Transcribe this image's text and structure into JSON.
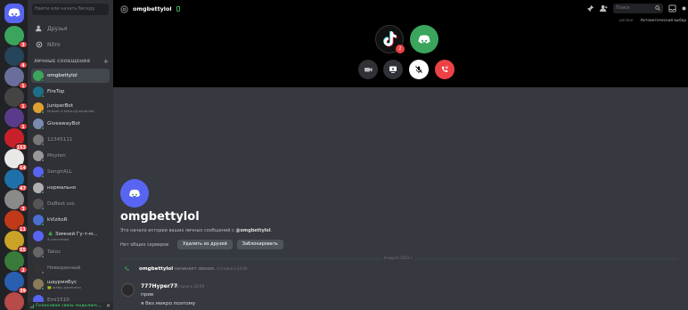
{
  "servers": [
    {
      "type": "home",
      "icon": "discord-logo-icon",
      "badge": ""
    },
    {
      "icon": "server-icon",
      "badge": "3"
    },
    {
      "icon": "server-icon",
      "badge": "4"
    },
    {
      "icon": "server-icon",
      "badge": "1"
    },
    {
      "icon": "server-icon",
      "badge": "1"
    },
    {
      "icon": "server-icon",
      "badge": "1"
    },
    {
      "icon": "server-icon",
      "badge": "153"
    },
    {
      "icon": "server-icon",
      "badge": "14"
    },
    {
      "icon": "server-icon",
      "badge": "47"
    },
    {
      "icon": "server-icon",
      "badge": "3"
    },
    {
      "icon": "server-icon",
      "badge": "11"
    },
    {
      "icon": "server-icon",
      "badge": "55"
    },
    {
      "icon": "server-icon",
      "badge": "2"
    },
    {
      "icon": "server-icon",
      "badge": "39"
    },
    {
      "icon": "server-icon",
      "badge": ""
    }
  ],
  "sidebar": {
    "search_placeholder": "Найти или начать беседу",
    "friends": "Друзья",
    "nitro": "Nitro",
    "dm_header": "ЛИЧНЫЕ СООБЩЕНИЯ",
    "dm_add": "+",
    "dms": [
      {
        "name": "omgbettylol",
        "sub": "",
        "active": true
      },
      {
        "name": "FireTop",
        "sub": ""
      },
      {
        "name": "JuniperBot",
        "sub": "Играет в https://juniper.bot"
      },
      {
        "name": "GiveawayBot",
        "sub": ""
      },
      {
        "name": "12345111",
        "sub": "",
        "dim": true
      },
      {
        "name": "Moyten",
        "sub": "",
        "dim": true
      },
      {
        "name": "SangirALL",
        "sub": "",
        "dim": true
      },
      {
        "name": "нормально",
        "sub": ""
      },
      {
        "name": "DaBest.sss",
        "sub": "",
        "dim": true
      },
      {
        "name": "kVizitoR",
        "sub": ""
      },
      {
        "name": "🎄 Зимний Гу-т-м...",
        "sub": "4 участника"
      },
      {
        "name": "Takoc",
        "sub": "",
        "dim": true
      },
      {
        "name": "Невиданный",
        "sub": "",
        "dim": true
      },
      {
        "name": "шаурмяБус",
        "sub": "🐸 жабы длинноти"
      },
      {
        "name": "Emi1510",
        "sub": "",
        "dim": true
      }
    ],
    "voice_status": "Голосовая связь подключ..."
  },
  "header": {
    "channel_name": "omgbettylol",
    "search_placeholder": "Поиск",
    "sub_left": "регион",
    "sub_right": "Автоматический выбор"
  },
  "call": {
    "tiktok_badge": "2"
  },
  "intro": {
    "name": "omgbettylol",
    "desc_prefix": "Это начало истории ваших личных сообщений с ",
    "desc_user": "@omgbettylol",
    "desc_suffix": ".",
    "no_servers": "Нет общих серверов",
    "remove_friend": "Удалить из друзей",
    "block": "Заблокировать"
  },
  "messages": {
    "date_divider": "8 марта 2023 г.",
    "system_user": "omgbettylol",
    "system_text": "начинает звонок.",
    "system_time": "Сегодня в 20:09",
    "author": "777Hyper77",
    "time": "Сегодня в 20:09",
    "lines": [
      "прив",
      "я без микро поэтому"
    ]
  },
  "colors": {
    "blurple": "#5865f2",
    "danger": "#ed4245",
    "green": "#3ba55d"
  }
}
